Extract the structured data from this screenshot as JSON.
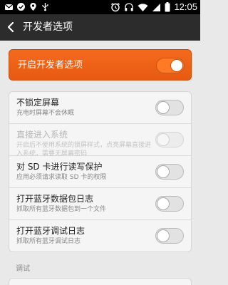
{
  "status_bar": {
    "time": "12:05"
  },
  "action_bar": {
    "title": "开发者选项"
  },
  "master_toggle": {
    "label": "开启开发者选项",
    "enabled": true
  },
  "settings": [
    {
      "title": "不锁定屏幕",
      "subtitle": "充电时屏幕不会休眠",
      "state": "off"
    },
    {
      "title": "直接进入系统",
      "subtitle": "开启后不使用系统的锁屏样式，点亮屏幕直接进入系统，需要无屏幕密码",
      "state": "disabled"
    },
    {
      "title": "对 SD 卡进行读写保护",
      "subtitle": "应用必须请求读取 SD 卡的权限",
      "state": "off"
    },
    {
      "title": "打开蓝牙数据包日志",
      "subtitle": "抓取所有蓝牙数据包到一个文件",
      "state": "off"
    },
    {
      "title": "打开蓝牙调试日志",
      "subtitle": "抓取所有蓝牙调试日志",
      "state": "off"
    }
  ],
  "section_header": "调试",
  "colors": {
    "accent": "#f36a1d",
    "action_bar": "#2c2c2c",
    "background": "#e9e9e9"
  }
}
